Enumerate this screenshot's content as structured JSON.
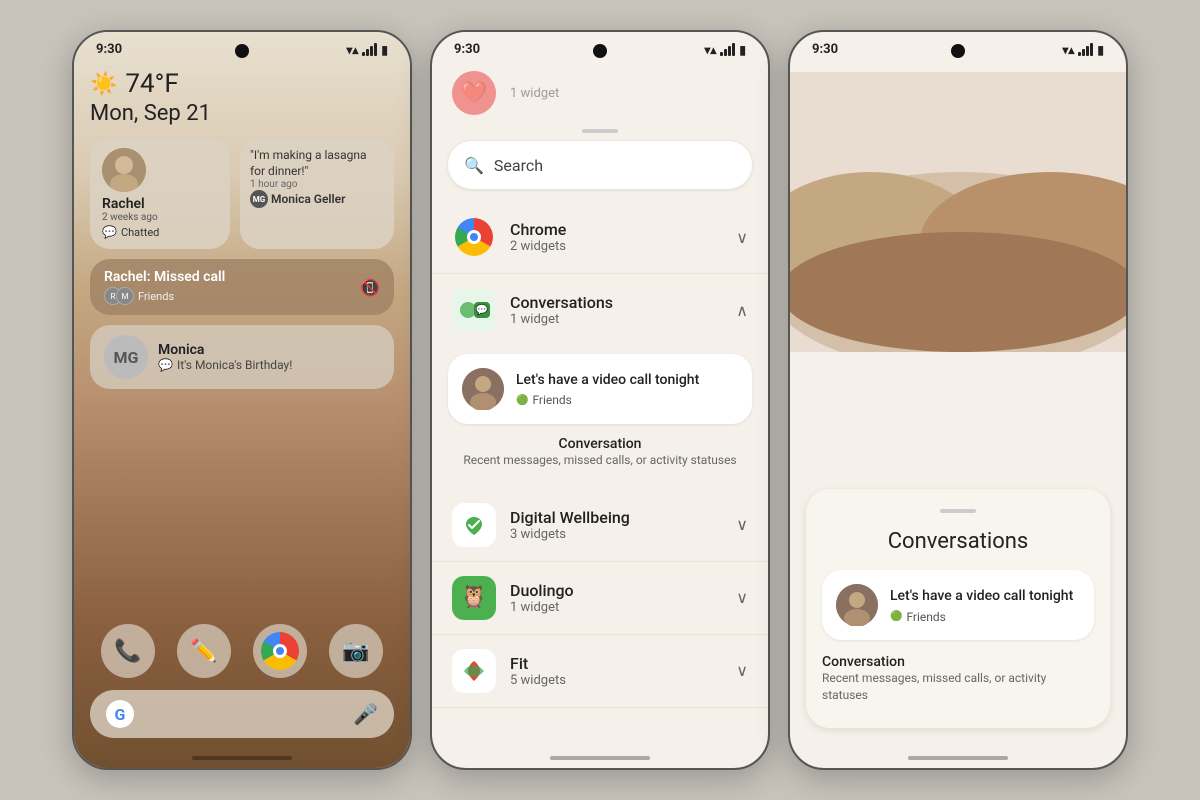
{
  "phone1": {
    "status": {
      "time": "9:30"
    },
    "weather": {
      "icon": "☀️",
      "temp": "74°F",
      "date": "Mon, Sep 21"
    },
    "rachel_bubble": {
      "name": "Rachel",
      "time": "2 weeks ago",
      "status": "Chatted"
    },
    "monica_bubble": {
      "message": "\"I'm making a lasagna for dinner!\"",
      "time": "1 hour ago",
      "name": "Monica Geller"
    },
    "missed_call": {
      "name": "Rachel: Missed call",
      "group": "Friends"
    },
    "monica2": {
      "initials": "MG",
      "name": "Monica",
      "message": "It's Monica's Birthday!"
    },
    "dock": {
      "phone": "📞",
      "pen": "✏️",
      "chrome": "🌐",
      "camera": "📷"
    },
    "google_bar": {
      "g_letter": "G",
      "mic": "🎤"
    }
  },
  "phone2": {
    "status": {
      "time": "9:30"
    },
    "search": {
      "placeholder": "Search"
    },
    "partial_top": {
      "label": "1 widget"
    },
    "chrome": {
      "name": "Chrome",
      "count": "2 widgets",
      "expanded": false
    },
    "conversations": {
      "name": "Conversations",
      "count": "1 widget",
      "expanded": true
    },
    "conversations_widget": {
      "message": "Let's have a video call tonight",
      "group": "Friends",
      "title": "Conversation",
      "subtitle": "Recent messages, missed calls, or activity statuses"
    },
    "digital_wellbeing": {
      "name": "Digital Wellbeing",
      "count": "3 widgets"
    },
    "duolingo": {
      "name": "Duolingo",
      "count": "1 widget"
    },
    "fit": {
      "name": "Fit",
      "count": "5 widgets"
    }
  },
  "phone3": {
    "status": {
      "time": "9:30"
    },
    "card": {
      "title": "Conversations",
      "widget_message": "Let's have a video call tonight",
      "widget_group": "Friends",
      "desc_title": "Conversation",
      "desc_subtitle": "Recent messages, missed calls, or activity statuses"
    }
  }
}
